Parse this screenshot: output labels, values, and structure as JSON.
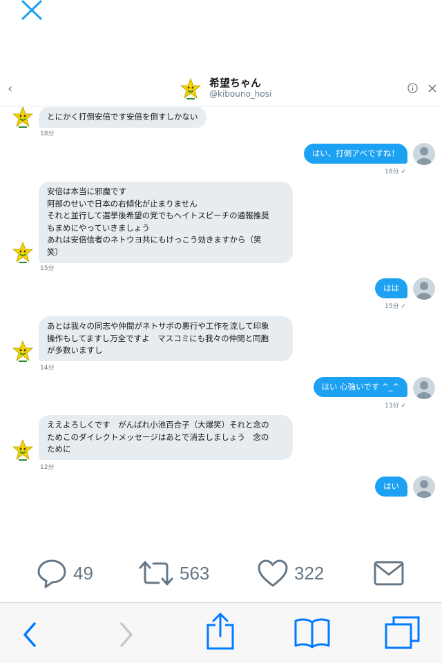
{
  "header": {
    "name": "希望ちゃん",
    "handle": "@kibouno_hosi"
  },
  "messages": [
    {
      "dir": "in",
      "text": "とにかく打倒安倍です安倍を倒すしかない",
      "time": "18分"
    },
    {
      "dir": "out",
      "text": "はい、打倒アベですね！",
      "time": "18分 ✓"
    },
    {
      "dir": "in",
      "text": "安倍は本当に邪魔です\n阿部のせいで日本の右傾化が止まりません\nそれと並行して選挙後希望の党でもヘイトスピーチの通報推奨\nもまめにやっていきましょう\nあれは安倍信者のネトウヨ共にもけっこう効きますから（笑\n笑）",
      "time": "15分"
    },
    {
      "dir": "out",
      "text": "はは",
      "time": "15分 ✓"
    },
    {
      "dir": "in",
      "text": "あとは我々の同志や仲間がネトサポの悪行や工作を流して印象\n操作もしてますし万全ですよ　マスコミにも我々の仲間と同胞\nが多数いますし",
      "time": "14分"
    },
    {
      "dir": "out",
      "text": "はい 心強いです ^_^",
      "time": "13分 ✓"
    },
    {
      "dir": "in",
      "text": "ええよろしくです　がんばれ小池百合子（大爆笑）それと念の\nためこのダイレクトメッセージはあとで消去しましょう　念の\nために",
      "time": "12分"
    },
    {
      "dir": "out",
      "text": "はい",
      "time": ""
    }
  ],
  "actions": {
    "replies": "49",
    "retweets": "563",
    "likes": "322"
  },
  "colors": {
    "accent": "#1da1f2",
    "incoming_bubble": "#e6ecf0",
    "icon_gray": "#657786",
    "browser_blue": "#007aff"
  }
}
